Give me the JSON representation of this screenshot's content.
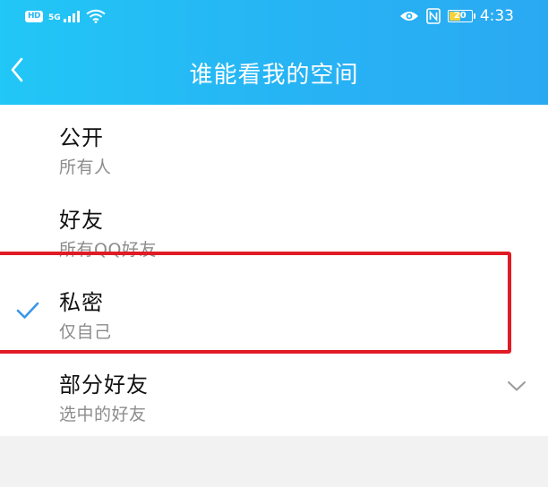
{
  "status_bar": {
    "hd": "HD",
    "network": "5G",
    "battery_level": "20",
    "time": "4:33"
  },
  "nav": {
    "title": "谁能看我的空间"
  },
  "options": [
    {
      "title": "公开",
      "subtitle": "所有人",
      "selected": false
    },
    {
      "title": "好友",
      "subtitle": "所有QQ好友",
      "selected": false
    },
    {
      "title": "私密",
      "subtitle": "仅自己",
      "selected": true
    },
    {
      "title": "部分好友",
      "subtitle": "选中的好友",
      "selected": false
    }
  ],
  "colors": {
    "header_gradient_start": "#21c7f6",
    "header_gradient_end": "#2aa9f2",
    "check_mark": "#3a96e8",
    "highlight_border": "#e01b24",
    "subtitle_text": "#8c8c8c",
    "battery_fill": "#f3d33b"
  },
  "icons": {
    "back": "chevron-left-icon",
    "selected": "check-icon",
    "expand": "chevron-down-icon"
  }
}
